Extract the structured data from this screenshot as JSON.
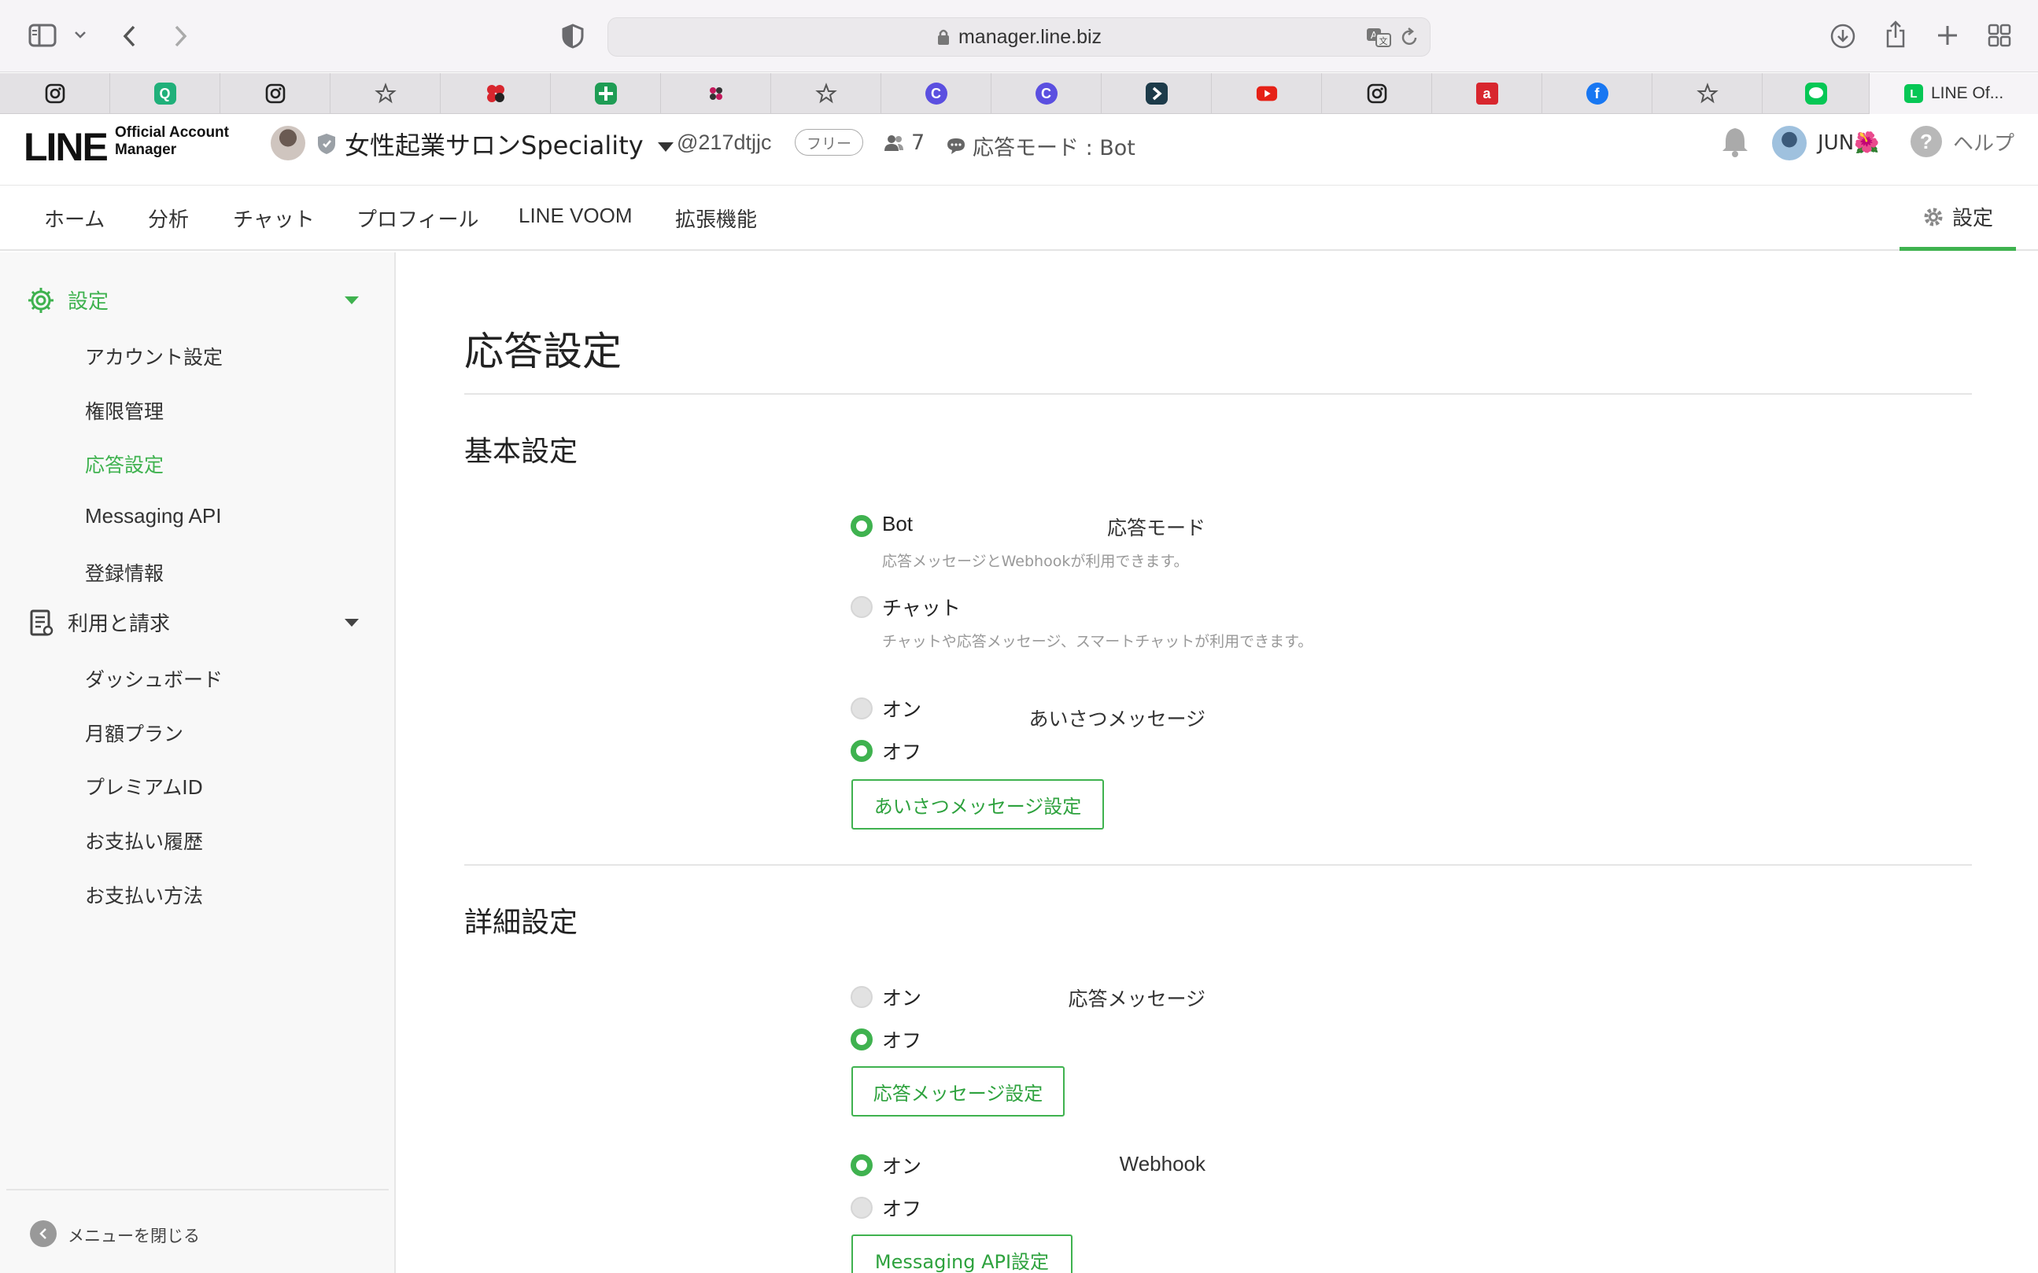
{
  "browser": {
    "url": "manager.line.biz",
    "active_tab_title": "LINE Of...",
    "favorites": [
      {
        "icon": "instagram-icon"
      },
      {
        "icon": "q-app-icon"
      },
      {
        "icon": "instagram-icon"
      },
      {
        "icon": "star-icon"
      },
      {
        "icon": "flower-app-icon"
      },
      {
        "icon": "plus-app-icon"
      },
      {
        "icon": "dots-app-icon"
      },
      {
        "icon": "star-icon"
      },
      {
        "icon": "c-app-icon"
      },
      {
        "icon": "c-app-icon"
      },
      {
        "icon": "arrow-app-icon"
      },
      {
        "icon": "youtube-icon"
      },
      {
        "icon": "instagram-icon"
      },
      {
        "icon": "a-app-icon"
      },
      {
        "icon": "facebook-icon"
      },
      {
        "icon": "star-icon"
      },
      {
        "icon": "line-icon"
      }
    ]
  },
  "header": {
    "logo": "LINE",
    "logo_sub1": "Official Account",
    "logo_sub2": "Manager",
    "account_name": "女性起業サロンSpeciality",
    "account_id": "@217dtjjc",
    "plan": "フリー",
    "friends_count": "7",
    "mode_label": "応答モード : Bot",
    "user_name": "JUN🌺",
    "help_label": "ヘルプ"
  },
  "nav": {
    "tabs": [
      "ホーム",
      "分析",
      "チャット",
      "プロフィール",
      "LINE VOOM",
      "拡張機能"
    ],
    "settings_label": "設定"
  },
  "sidebar": {
    "group1_label": "設定",
    "group1_items": [
      "アカウント設定",
      "権限管理",
      "応答設定",
      "Messaging API",
      "登録情報"
    ],
    "group2_label": "利用と請求",
    "group2_items": [
      "ダッシュボード",
      "月額プラン",
      "プレミアムID",
      "お支払い履歴",
      "お支払い方法"
    ],
    "close_label": "メニューを閉じる",
    "colors": {
      "active": "#3fb24f"
    }
  },
  "main": {
    "page_title": "応答設定",
    "basic_title": "基本設定",
    "response_mode_label": "応答モード",
    "bot_label": "Bot",
    "bot_desc": "応答メッセージとWebhookが利用できます。",
    "chat_label": "チャット",
    "chat_desc": "チャットや応答メッセージ、スマートチャットが利用できます。",
    "greeting_label": "あいさつメッセージ",
    "on_label": "オン",
    "off_label": "オフ",
    "greeting_btn": "あいさつメッセージ設定",
    "detail_title": "詳細設定",
    "auto_reply_label": "応答メッセージ",
    "auto_reply_btn": "応答メッセージ設定",
    "webhook_label": "Webhook",
    "webhook_btn": "Messaging API設定"
  }
}
